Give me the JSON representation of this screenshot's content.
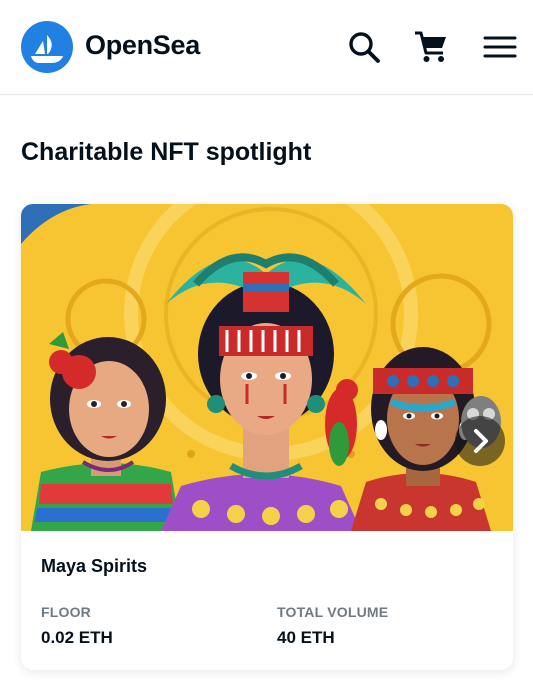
{
  "header": {
    "brand": "OpenSea",
    "icons": [
      "opensea-logo-icon",
      "search-icon",
      "cart-icon",
      "menu-icon"
    ]
  },
  "spotlight": {
    "title": "Charitable NFT spotlight",
    "card": {
      "name": "Maya Spirits",
      "floor_label": "FLOOR",
      "floor_value": "0.02 ETH",
      "volume_label": "TOTAL VOLUME",
      "volume_value": "40 ETH"
    }
  },
  "colors": {
    "brand_blue": "#2081e2",
    "text_primary": "#04111d",
    "text_secondary": "#707a83",
    "art_background": "#f7c531"
  }
}
